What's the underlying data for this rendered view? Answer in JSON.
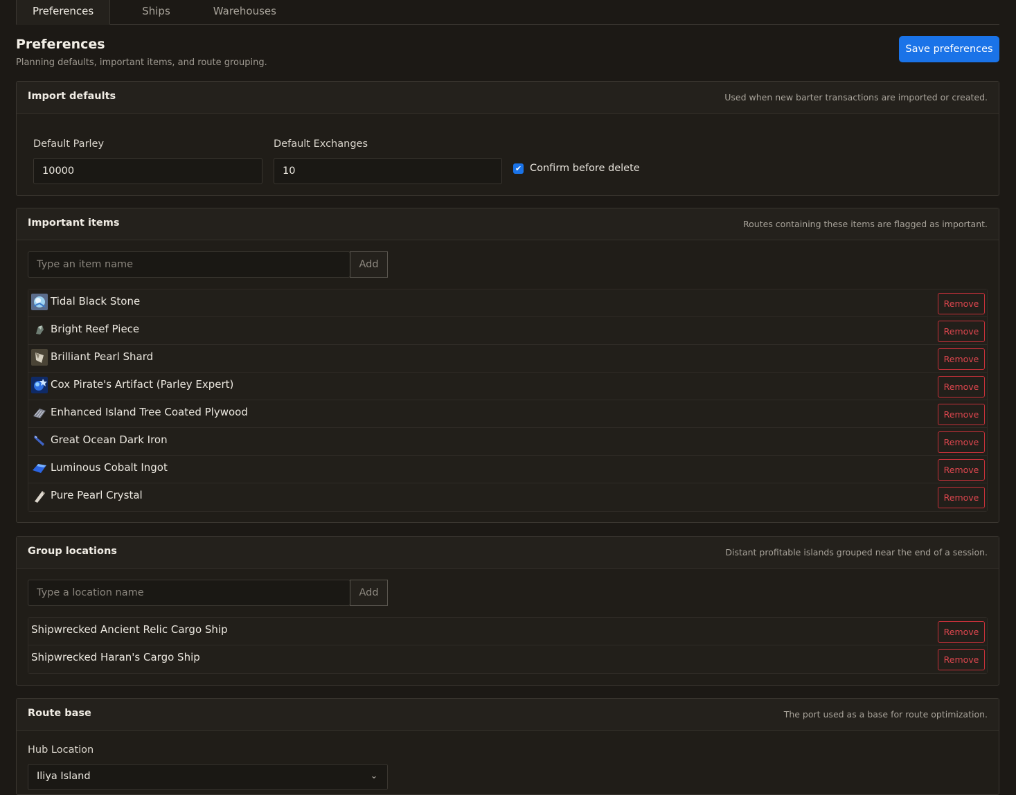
{
  "tabs": [
    {
      "label": "Preferences"
    },
    {
      "label": "Ships"
    },
    {
      "label": "Warehouses"
    }
  ],
  "page": {
    "title": "Preferences",
    "subtitle": "Planning defaults, important items, and route grouping.",
    "save_label": "Save preferences"
  },
  "import_defaults": {
    "title": "Import defaults",
    "note": "Used when new barter transactions are imported or created.",
    "parley_label": "Default Parley",
    "parley_value": "10000",
    "exchanges_label": "Default Exchanges",
    "exchanges_value": "10",
    "confirm_label": "Confirm before delete",
    "confirm_checked": true
  },
  "important_items": {
    "title": "Important items",
    "note": "Routes containing these items are flagged as important.",
    "placeholder": "Type an item name",
    "add_label": "Add",
    "remove_label": "Remove",
    "items": [
      {
        "name": "Tidal Black Stone",
        "icon": "black-stone-icon"
      },
      {
        "name": "Bright Reef Piece",
        "icon": "reef-piece-icon"
      },
      {
        "name": "Brilliant Pearl Shard",
        "icon": "pearl-shard-icon"
      },
      {
        "name": "Cox Pirate's Artifact (Parley Expert)",
        "icon": "artifact-icon"
      },
      {
        "name": "Enhanced Island Tree Coated Plywood",
        "icon": "plywood-icon"
      },
      {
        "name": "Great Ocean Dark Iron",
        "icon": "dark-iron-icon"
      },
      {
        "name": "Luminous Cobalt Ingot",
        "icon": "cobalt-ingot-icon"
      },
      {
        "name": "Pure Pearl Crystal",
        "icon": "pearl-crystal-icon"
      }
    ]
  },
  "group_locations": {
    "title": "Group locations",
    "note": "Distant profitable islands grouped near the end of a session.",
    "placeholder": "Type a location name",
    "add_label": "Add",
    "remove_label": "Remove",
    "items": [
      {
        "name": "Shipwrecked Ancient Relic Cargo Ship"
      },
      {
        "name": "Shipwrecked Haran's Cargo Ship"
      }
    ]
  },
  "route_base": {
    "title": "Route base",
    "note": "The port used as a base for route optimization.",
    "hub_label": "Hub Location",
    "hub_value": "Iliya Island"
  }
}
